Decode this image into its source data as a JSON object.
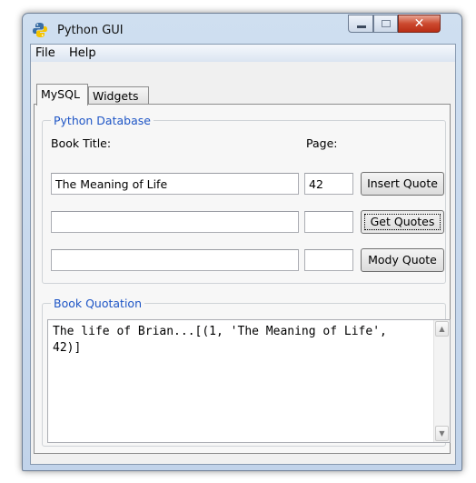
{
  "window": {
    "title": "Python GUI"
  },
  "menu": {
    "items": [
      "File",
      "Help"
    ]
  },
  "tabs": [
    {
      "label": "MySQL",
      "active": true
    },
    {
      "label": "Widgets",
      "active": false
    }
  ],
  "database_group": {
    "title": "Python Database",
    "book_title_label": "Book Title:",
    "page_label": "Page:",
    "rows": [
      {
        "title_value": "The Meaning of Life",
        "page_value": "42",
        "button": "Insert Quote"
      },
      {
        "title_value": "",
        "page_value": "",
        "button": "Get Quotes"
      },
      {
        "title_value": "",
        "page_value": "",
        "button": "Mody Quote"
      }
    ]
  },
  "quotation_group": {
    "title": "Book Quotation",
    "text": "The life of Brian...[(1, 'The Meaning of Life', 42)]"
  },
  "icons": {
    "app": "python-icon",
    "minimize": "minimize-icon",
    "maximize": "maximize-icon",
    "close": "close-icon",
    "scroll_up": "scroll-up-icon",
    "scroll_down": "scroll-down-icon"
  },
  "colors": {
    "group_title": "#1f56c6",
    "close_button": "#cc4a2f"
  }
}
